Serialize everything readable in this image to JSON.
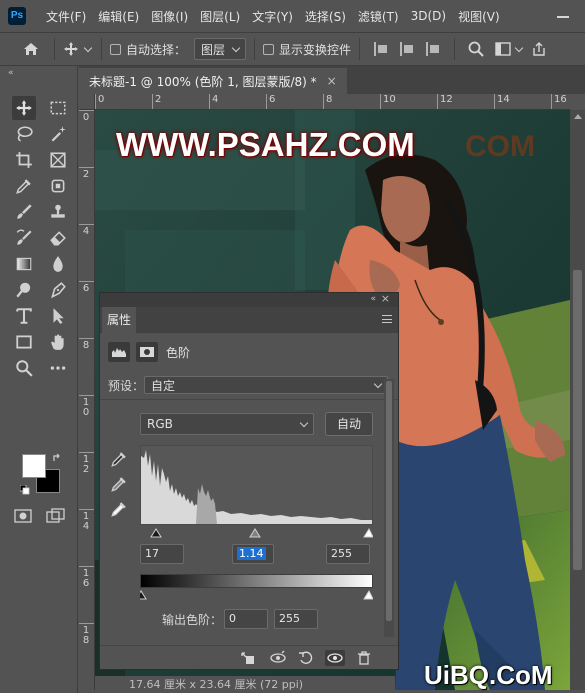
{
  "app": {
    "logo": "Ps"
  },
  "menubar": {
    "items": [
      "文件(F)",
      "编辑(E)",
      "图像(I)",
      "图层(L)",
      "文字(Y)",
      "选择(S)",
      "滤镜(T)",
      "3D(D)",
      "视图(V)"
    ]
  },
  "options": {
    "auto_select_label": "自动选择：",
    "auto_select_target": "图层",
    "show_transform_label": "显示变换控件"
  },
  "document": {
    "tab_title": "未标题-1 @ 100% (色阶 1, 图层蒙版/8) *",
    "close_glyph": "×",
    "status": "17.64 厘米 x 23.64 厘米 (72 ppi)"
  },
  "rulers": {
    "top_labels": [
      "0",
      "2",
      "4",
      "6",
      "8",
      "10",
      "12",
      "14",
      "16"
    ],
    "left_labels": [
      "0",
      "2",
      "4",
      "6",
      "8",
      "1\n0",
      "1\n2",
      "1\n4",
      "1\n6",
      "1\n8"
    ]
  },
  "canvas": {
    "watermark": "WWW.PSAHZ.COM",
    "watermark_ghost": "COM",
    "corner_logo": "UiBQ.CoM"
  },
  "properties": {
    "tab_label": "属性",
    "adjustment_title": "色阶",
    "preset_label": "预设：",
    "preset_value": "自定",
    "channel": "RGB",
    "auto_label": "自动",
    "input_black": "17",
    "input_gamma": "1.14",
    "input_white": "255",
    "output_label": "输出色阶：",
    "output_black": "0",
    "output_white": "255"
  },
  "colors": {
    "ui_bg": "#535353",
    "dark_bar": "#424242",
    "selection": "#1d6fd0",
    "watermark_glow": "#7a0000"
  },
  "icons": {
    "toolbar": [
      "move-tool-icon",
      "marquee-tool-icon",
      "lasso-tool-icon",
      "magic-wand-icon",
      "crop-tool-icon",
      "frame-tool-icon",
      "eyedropper-icon",
      "spot-healing-icon",
      "brush-icon",
      "stamp-icon",
      "history-brush-icon",
      "eraser-icon",
      "gradient-icon",
      "blur-icon",
      "dodge-icon",
      "pen-icon",
      "type-icon",
      "path-select-icon",
      "rectangle-icon",
      "hand-icon",
      "zoom-icon",
      "more-tools-icon"
    ],
    "properties_footer": [
      "clip-to-layer-icon",
      "view-previous-icon",
      "reset-icon",
      "visibility-icon",
      "delete-icon"
    ]
  }
}
